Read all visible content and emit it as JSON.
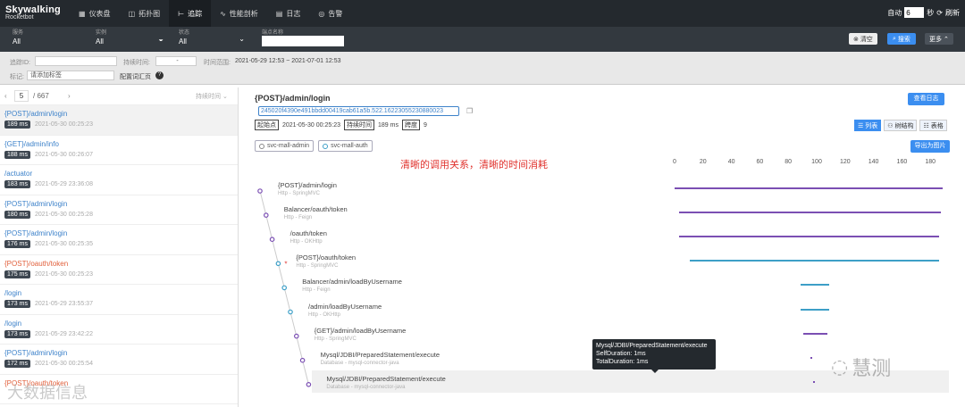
{
  "app": {
    "logo_line1": "Skywalking",
    "logo_line2": "Rocketbot"
  },
  "nav": [
    {
      "icon": "dashboard-icon",
      "glyph": "▦",
      "label": "仪表盘"
    },
    {
      "icon": "topology-icon",
      "glyph": "◫",
      "label": "拓扑图"
    },
    {
      "icon": "trace-icon",
      "glyph": "⊢",
      "label": "追踪"
    },
    {
      "icon": "profile-icon",
      "glyph": "∿",
      "label": "性能剖析"
    },
    {
      "icon": "log-icon",
      "glyph": "▤",
      "label": "日志"
    },
    {
      "icon": "alarm-icon",
      "glyph": "◎",
      "label": "告警"
    }
  ],
  "auto": {
    "label": "自动",
    "value": "6",
    "unit": "秒",
    "refresh": "刷新"
  },
  "filters": {
    "service": {
      "label": "服务",
      "value": "All"
    },
    "instance": {
      "label": "实例",
      "value": "All"
    },
    "status": {
      "label": "状态",
      "value": "All"
    },
    "endpoint": {
      "label": "端点名称",
      "value": ""
    }
  },
  "buttons": {
    "clear": "清空",
    "search": "搜索",
    "more": "更多"
  },
  "second": {
    "trace_id_label": "追踪ID:",
    "duration_label": "持续时间:",
    "duration_sep": "-",
    "time_range_label": "时间范围:",
    "time_range_value": "2021-05-29 12:53 ~ 2021-07-01 12:53",
    "tags_label": "标记:",
    "tags_placeholder": "请添加标签",
    "config_tip": "配置词汇页"
  },
  "list": {
    "page": "5",
    "total": "/ 667",
    "sort": "持续时间",
    "rows": [
      {
        "name": "{POST}/admin/login",
        "duration": "189 ms",
        "time": "2021-05-30 00:25:23",
        "error": false,
        "selected": true
      },
      {
        "name": "{GET}/admin/info",
        "duration": "188 ms",
        "time": "2021-05-30 00:26:07",
        "error": false,
        "selected": false
      },
      {
        "name": "/actuator",
        "duration": "183 ms",
        "time": "2021-05-29 23:36:08",
        "error": false,
        "selected": false
      },
      {
        "name": "{POST}/admin/login",
        "duration": "180 ms",
        "time": "2021-05-30 00:25:28",
        "error": false,
        "selected": false
      },
      {
        "name": "{POST}/admin/login",
        "duration": "176 ms",
        "time": "2021-05-30 00:25:35",
        "error": false,
        "selected": false
      },
      {
        "name": "{POST}/oauth/token",
        "duration": "175 ms",
        "time": "2021-05-30 00:25:23",
        "error": true,
        "selected": false
      },
      {
        "name": "/login",
        "duration": "173 ms",
        "time": "2021-05-29 23:55:37",
        "error": false,
        "selected": false
      },
      {
        "name": "/login",
        "duration": "173 ms",
        "time": "2021-05-29 23:42:22",
        "error": false,
        "selected": false
      },
      {
        "name": "{POST}/admin/login",
        "duration": "172 ms",
        "time": "2021-05-30 00:25:54",
        "error": false,
        "selected": false
      },
      {
        "name": "{POST}/oauth/token",
        "duration": "",
        "time": "",
        "error": true,
        "selected": false
      }
    ]
  },
  "detail": {
    "title": "{POST}/admin/login",
    "trace_id": "245020f4390e491bbdd00419cab61a5b.522.16223055230880023",
    "view_log": "查看日志",
    "start_label": "起始点",
    "start_value": "2021-05-30 00:25:23",
    "duration_label": "持续时间",
    "duration_value": "189 ms",
    "depth_label": "跨度",
    "depth_value": "9",
    "views": [
      "列表",
      "树结构",
      "表格"
    ],
    "services": [
      "svc-mall-admin",
      "svc-mall-auth"
    ],
    "export": "导出为图片",
    "annotation": "清晰的调用关系，清晰的时间消耗",
    "scale": [
      "0",
      "20",
      "40",
      "60",
      "80",
      "100",
      "120",
      "140",
      "160",
      "180"
    ],
    "spans": [
      {
        "name": "{POST}/admin/login",
        "component": "Http - SpringMVC",
        "start": 0,
        "end": 189,
        "color": "#7b4fb3"
      },
      {
        "name": "Balancer/oauth/token",
        "component": "Http - Feign",
        "start": 3,
        "end": 188,
        "color": "#7b4fb3"
      },
      {
        "name": "/oauth/token",
        "component": "Http - OKHttp",
        "start": 3,
        "end": 187,
        "color": "#7b4fb3"
      },
      {
        "name": "{POST}/oauth/token",
        "component": "Http - SpringMVC",
        "start": 11,
        "end": 187,
        "color": "#3d9fc7"
      },
      {
        "name": "Balancer/admin/loadByUsername",
        "component": "Http - Feign",
        "start": 89,
        "end": 109,
        "color": "#3d9fc7"
      },
      {
        "name": "/admin/loadByUsername",
        "component": "Http - OKHttp",
        "start": 89,
        "end": 109,
        "color": "#3d9fc7"
      },
      {
        "name": "{GET}/admin/loadByUsername",
        "component": "Http - SpringMVC",
        "start": 91,
        "end": 108,
        "color": "#7b4fb3"
      },
      {
        "name": "Mysql/JDBI/PreparedStatement/execute",
        "component": "Database - mysql-connector-java",
        "start": 96,
        "end": 97,
        "color": "#7b4fb3"
      },
      {
        "name": "Mysql/JDBI/PreparedStatement/execute",
        "component": "Database - mysql-connector-java",
        "start": 98,
        "end": 99,
        "color": "#7b4fb3"
      }
    ],
    "tooltip": {
      "name": "Mysql/JDBI/PreparedStatement/execute",
      "self": "SelfDuration: 1ms",
      "total": "TotalDuration: 1ms"
    }
  },
  "watermarks": {
    "right": "慧测",
    "left": "大数据信息"
  }
}
